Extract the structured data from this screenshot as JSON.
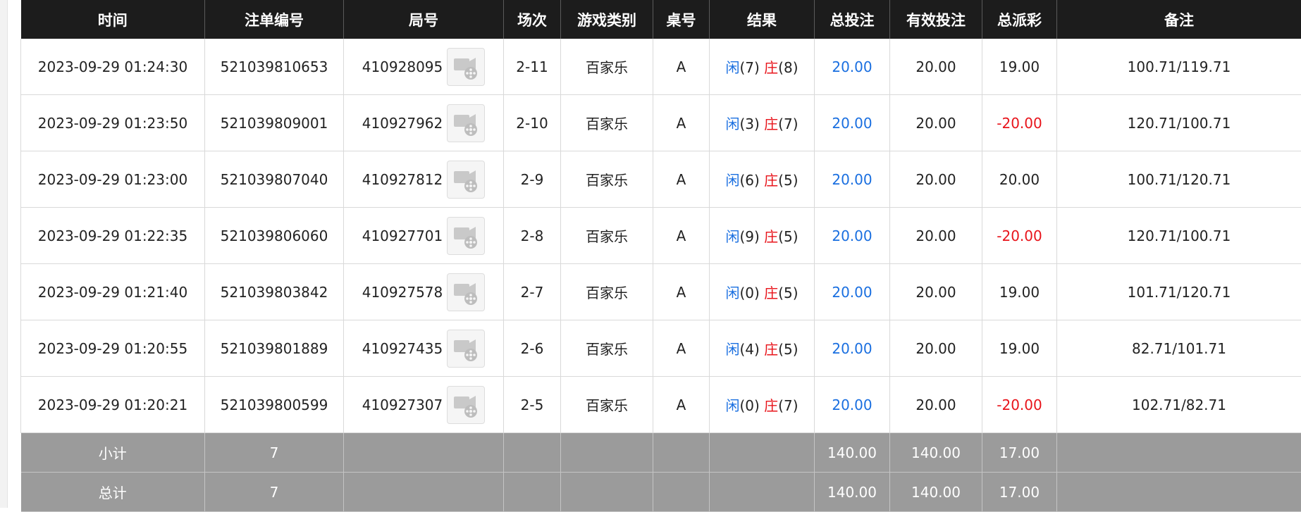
{
  "colors": {
    "header_bg": "#1c1c1c",
    "summary_bg": "#9b9b9b",
    "blue": "#1a6fe0",
    "red": "#e8141b"
  },
  "columns": [
    "时间",
    "注单编号",
    "局号",
    "场次",
    "游戏类别",
    "桌号",
    "结果",
    "总投注",
    "有效投注",
    "总派彩",
    "备注"
  ],
  "result_labels": {
    "player": "闲",
    "banker": "庄"
  },
  "video_icon": "film-reel-icon",
  "rows": [
    {
      "time": "2023-09-29 01:24:30",
      "bet_id": "521039810653",
      "round_id": "410928095",
      "session": "2-11",
      "game": "百家乐",
      "table": "A",
      "player": "(7)",
      "banker": "(8)",
      "total_bet": "20.00",
      "valid_bet": "20.00",
      "payout": "19.00",
      "payout_color": "#222222",
      "note": "100.71/119.71"
    },
    {
      "time": "2023-09-29 01:23:50",
      "bet_id": "521039809001",
      "round_id": "410927962",
      "session": "2-10",
      "game": "百家乐",
      "table": "A",
      "player": "(3)",
      "banker": "(7)",
      "total_bet": "20.00",
      "valid_bet": "20.00",
      "payout": "-20.00",
      "payout_color": "#e8141b",
      "note": "120.71/100.71"
    },
    {
      "time": "2023-09-29 01:23:00",
      "bet_id": "521039807040",
      "round_id": "410927812",
      "session": "2-9",
      "game": "百家乐",
      "table": "A",
      "player": "(6)",
      "banker": "(5)",
      "total_bet": "20.00",
      "valid_bet": "20.00",
      "payout": "20.00",
      "payout_color": "#222222",
      "note": "100.71/120.71"
    },
    {
      "time": "2023-09-29 01:22:35",
      "bet_id": "521039806060",
      "round_id": "410927701",
      "session": "2-8",
      "game": "百家乐",
      "table": "A",
      "player": "(9)",
      "banker": "(5)",
      "total_bet": "20.00",
      "valid_bet": "20.00",
      "payout": "-20.00",
      "payout_color": "#e8141b",
      "note": "120.71/100.71"
    },
    {
      "time": "2023-09-29 01:21:40",
      "bet_id": "521039803842",
      "round_id": "410927578",
      "session": "2-7",
      "game": "百家乐",
      "table": "A",
      "player": "(0)",
      "banker": "(5)",
      "total_bet": "20.00",
      "valid_bet": "20.00",
      "payout": "19.00",
      "payout_color": "#222222",
      "note": "101.71/120.71"
    },
    {
      "time": "2023-09-29 01:20:55",
      "bet_id": "521039801889",
      "round_id": "410927435",
      "session": "2-6",
      "game": "百家乐",
      "table": "A",
      "player": "(4)",
      "banker": "(5)",
      "total_bet": "20.00",
      "valid_bet": "20.00",
      "payout": "19.00",
      "payout_color": "#222222",
      "note": "82.71/101.71"
    },
    {
      "time": "2023-09-29 01:20:21",
      "bet_id": "521039800599",
      "round_id": "410927307",
      "session": "2-5",
      "game": "百家乐",
      "table": "A",
      "player": "(0)",
      "banker": "(7)",
      "total_bet": "20.00",
      "valid_bet": "20.00",
      "payout": "-20.00",
      "payout_color": "#e8141b",
      "note": "102.71/82.71"
    }
  ],
  "summary": [
    {
      "label": "小计",
      "count": "7",
      "total_bet": "140.00",
      "valid_bet": "140.00",
      "payout": "17.00"
    },
    {
      "label": "总计",
      "count": "7",
      "total_bet": "140.00",
      "valid_bet": "140.00",
      "payout": "17.00"
    }
  ]
}
